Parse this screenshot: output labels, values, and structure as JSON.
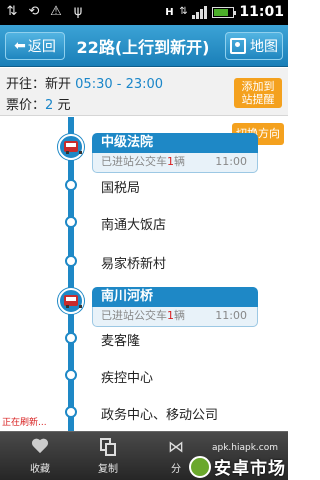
{
  "status_bar": {
    "time": "11:01",
    "data_indicator": "H",
    "icons": [
      "usb-transfer-icon",
      "sync-icon",
      "warning-icon",
      "usb-icon",
      "data-arrows-icon",
      "signal-icon",
      "battery-icon"
    ]
  },
  "header": {
    "back_label": "返回",
    "title": "22路(上行到新开)",
    "map_label": "地图"
  },
  "info": {
    "route_prefix": "开往：新开",
    "hours": "05:30 - 23:00",
    "fare_prefix": "票价：",
    "fare_amount": "2",
    "fare_unit": "元",
    "alert_button": "添加到站提醒"
  },
  "route": {
    "switch_direction": "切换方向",
    "stops": [
      {
        "name": "中级法院",
        "has_bus": true,
        "status_prefix": "已进站公交车",
        "bus_count": "1",
        "status_suffix": "辆",
        "time": "11:00"
      },
      {
        "name": "国税局",
        "has_bus": false
      },
      {
        "name": "南通大饭店",
        "has_bus": false
      },
      {
        "name": "易家桥新村",
        "has_bus": false
      },
      {
        "name": "南川河桥",
        "has_bus": true,
        "status_prefix": "已进站公交车",
        "bus_count": "1",
        "status_suffix": "辆",
        "time": "11:00"
      },
      {
        "name": "麦客隆",
        "has_bus": false
      },
      {
        "name": "疾控中心",
        "has_bus": false
      },
      {
        "name": "政务中心、移动公司",
        "has_bus": false
      }
    ],
    "refreshing": "正在刷新..."
  },
  "bottom_bar": {
    "tabs": [
      {
        "label": "收藏",
        "icon": "heart-icon"
      },
      {
        "label": "复制",
        "icon": "copy-icon"
      },
      {
        "label": "分",
        "icon": "share-icon"
      }
    ]
  },
  "watermark": {
    "url": "apk.hiapk.com",
    "text": "安卓市场"
  },
  "colors": {
    "accent": "#1e88c6",
    "orange": "#f4a11e",
    "red": "#d82020"
  }
}
